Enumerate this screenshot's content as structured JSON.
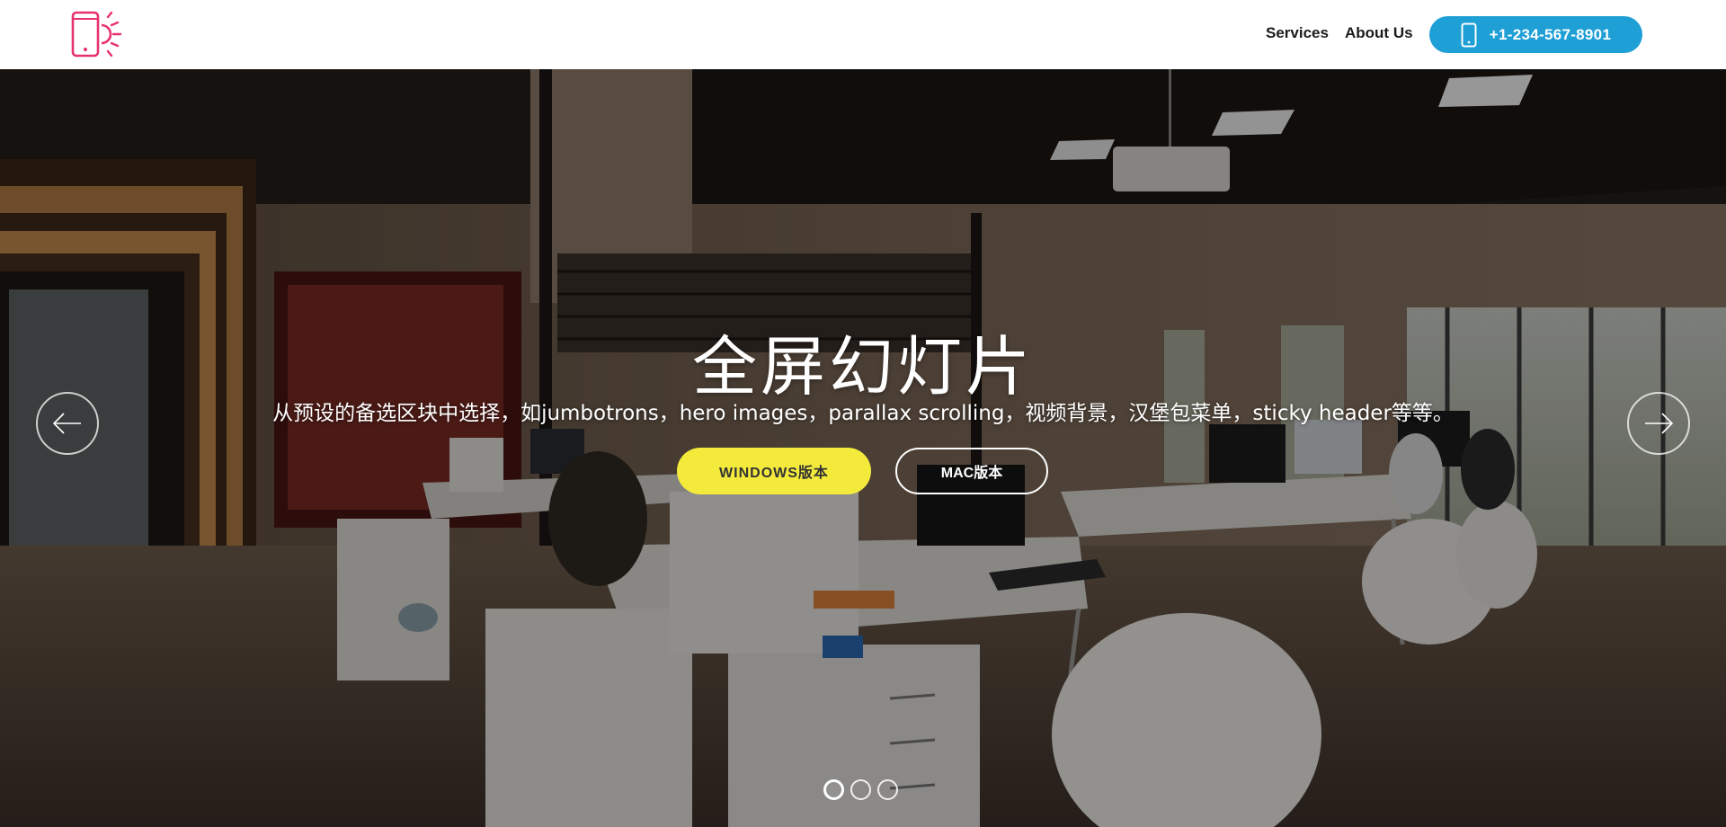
{
  "header": {
    "logo_icon": "phone-light-icon",
    "nav": [
      {
        "label": "Services"
      },
      {
        "label": "About Us"
      }
    ],
    "phone_button": {
      "label": "+1-234-567-8901",
      "icon": "mobile-phone-icon"
    }
  },
  "hero": {
    "title": "全屏幻灯片",
    "subtitle": "从预设的备选区块中选择，如jumbotrons，hero images，parallax scrolling，视频背景，汉堡包菜单，sticky header等等。",
    "primary_button": "WINDOWS版本",
    "secondary_button": "MAC版本",
    "prev_icon": "arrow-left-icon",
    "next_icon": "arrow-right-icon",
    "slide_count": 3,
    "active_slide": 1,
    "background_image": "office-interior"
  },
  "colors": {
    "accent_blue": "#1e9fd6",
    "accent_yellow": "#f3ea3c",
    "logo_pink": "#e8326f"
  }
}
